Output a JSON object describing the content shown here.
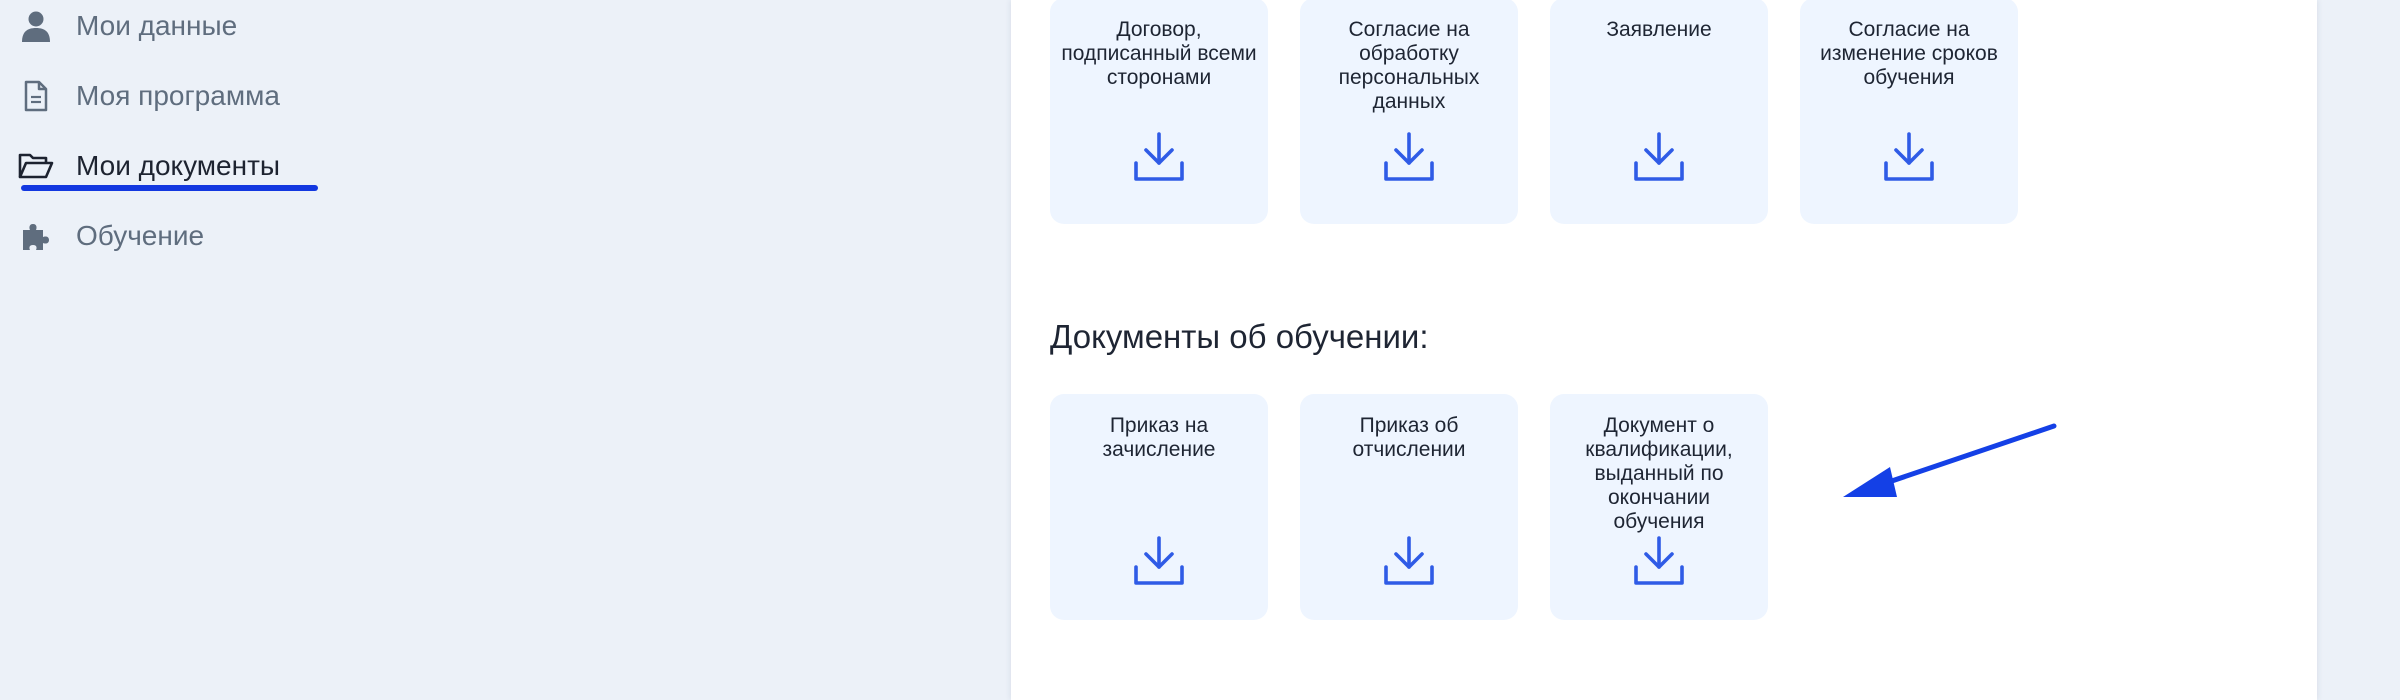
{
  "sidebar": {
    "items": [
      {
        "label": "Мои данные",
        "icon": "user-icon"
      },
      {
        "label": "Моя программа",
        "icon": "document-icon"
      },
      {
        "label": "Мои документы",
        "icon": "folder-open-icon",
        "active": true
      },
      {
        "label": "Обучение",
        "icon": "puzzle-icon"
      }
    ]
  },
  "main": {
    "top_cards": [
      {
        "title": "Договор, подписанный всеми сторонами",
        "icon": "download-icon"
      },
      {
        "title": "Согласие на обработку персональных данных",
        "icon": "download-icon"
      },
      {
        "title": "Заявление",
        "icon": "download-icon"
      },
      {
        "title": "Согласие на изменение сроков обучения",
        "icon": "download-icon"
      }
    ],
    "education_section": {
      "title": "Документы об обучении:",
      "cards": [
        {
          "title": "Приказ на зачисление",
          "icon": "download-icon"
        },
        {
          "title": "Приказ об отчислении",
          "icon": "download-icon"
        },
        {
          "title": "Документ о квалификации, выданный по окончании обучения",
          "icon": "download-icon"
        }
      ]
    }
  },
  "colors": {
    "accent": "#2f5be6",
    "active_underline": "#1338e0",
    "card_bg": "#eef5ff",
    "page_bg": "#ecf1f8",
    "annotation": "#1440e6"
  }
}
